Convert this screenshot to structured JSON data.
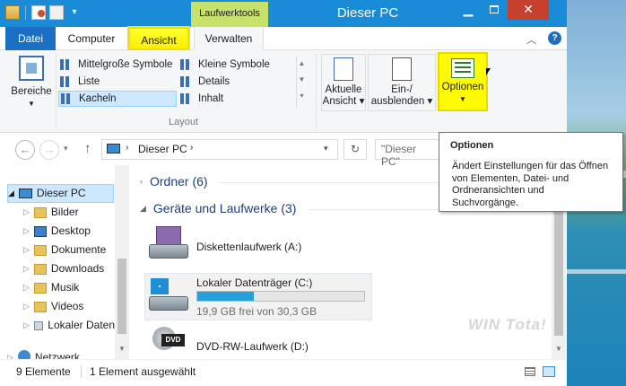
{
  "window": {
    "title": "Dieser PC",
    "context_tab": "Laufwerktools",
    "accent": "#1a8bd6"
  },
  "tabs": [
    {
      "label": "Datei"
    },
    {
      "label": "Computer"
    },
    {
      "label": "Ansicht"
    },
    {
      "label": "Verwalten"
    }
  ],
  "ribbon": {
    "panes": {
      "label": "Bereiche"
    },
    "layout": {
      "items": [
        "Mittelgroße Symbole",
        "Kleine Symbole",
        "Liste",
        "Details",
        "Kacheln",
        "Inhalt"
      ],
      "selected": "Kacheln",
      "group_label": "Layout"
    },
    "current_view": {
      "label1": "Aktuelle",
      "label2": "Ansicht"
    },
    "show_hide": {
      "label1": "Ein-/",
      "label2": "ausblenden"
    },
    "options": {
      "label": "Optionen"
    }
  },
  "address": {
    "path": "Dieser PC",
    "search_placeholder": "\"Dieser PC\""
  },
  "nav": {
    "items": [
      {
        "label": "Dieser PC"
      },
      {
        "label": "Bilder"
      },
      {
        "label": "Desktop"
      },
      {
        "label": "Dokumente"
      },
      {
        "label": "Downloads"
      },
      {
        "label": "Musik"
      },
      {
        "label": "Videos"
      },
      {
        "label": "Lokaler Daten"
      },
      {
        "label": "Netzwerk"
      }
    ]
  },
  "content": {
    "folders_section": "Ordner (6)",
    "drives_section": "Geräte und Laufwerke (3)",
    "drives": [
      {
        "name": "Diskettenlaufwerk (A:)"
      },
      {
        "name": "Lokaler Datenträger (C:)",
        "free_text": "19,9 GB frei von 30,3 GB",
        "used_fraction": 0.34
      },
      {
        "name": "DVD-RW-Laufwerk (D:)"
      }
    ]
  },
  "tooltip": {
    "title": "Optionen",
    "text": "Ändert Einstellungen für das Öffnen von Elementen, Datei- und Ordneransichten und Suchvorgänge."
  },
  "status": {
    "count": "9 Elemente",
    "selected": "1 Element ausgewählt"
  },
  "watermark": "WIN Tota!"
}
